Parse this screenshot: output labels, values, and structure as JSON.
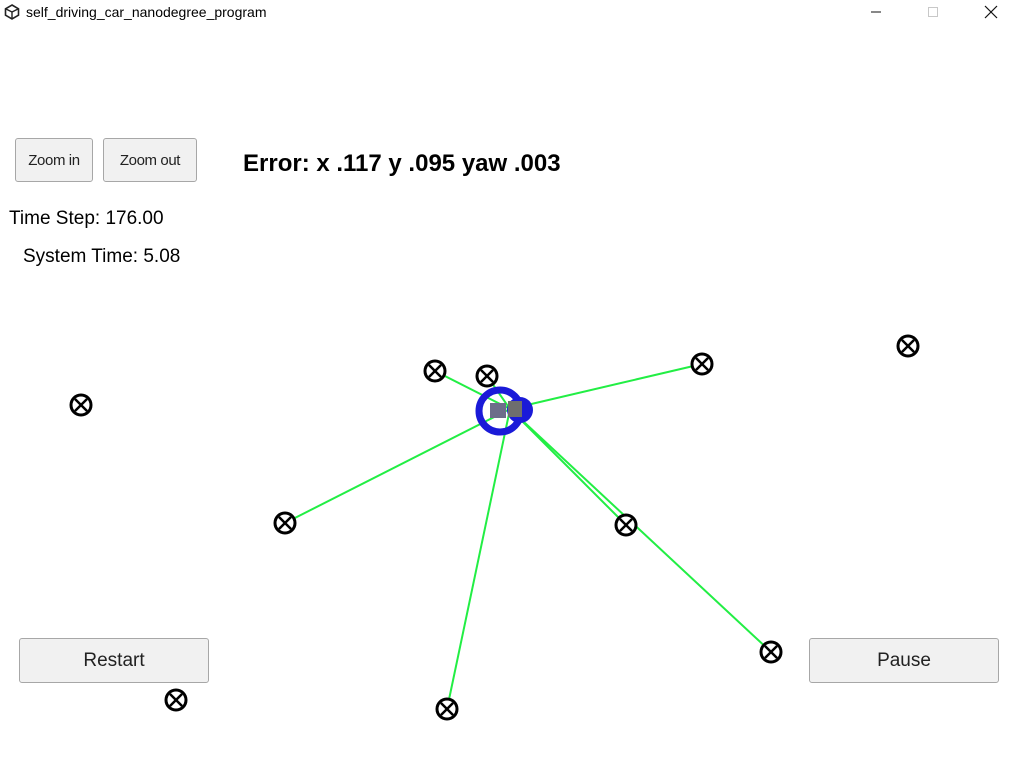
{
  "window": {
    "title": "self_driving_car_nanodegree_program",
    "app_icon": "unity-icon",
    "controls": [
      "minimize-icon",
      "maximize-icon",
      "close-icon"
    ]
  },
  "controls": {
    "zoom_in_label": "Zoom in",
    "zoom_out_label": "Zoom out",
    "restart_label": "Restart",
    "pause_label": "Pause"
  },
  "status": {
    "error": "Error: x .117 y .095 yaw .003",
    "time_step": "Time Step: 176.00",
    "system_time": "System Time: 5.08"
  },
  "colors": {
    "observation_line": "#22ee44",
    "vehicle": "#1a1ad8",
    "landmark": "#000000",
    "button_bg": "#f1f1f1"
  }
}
